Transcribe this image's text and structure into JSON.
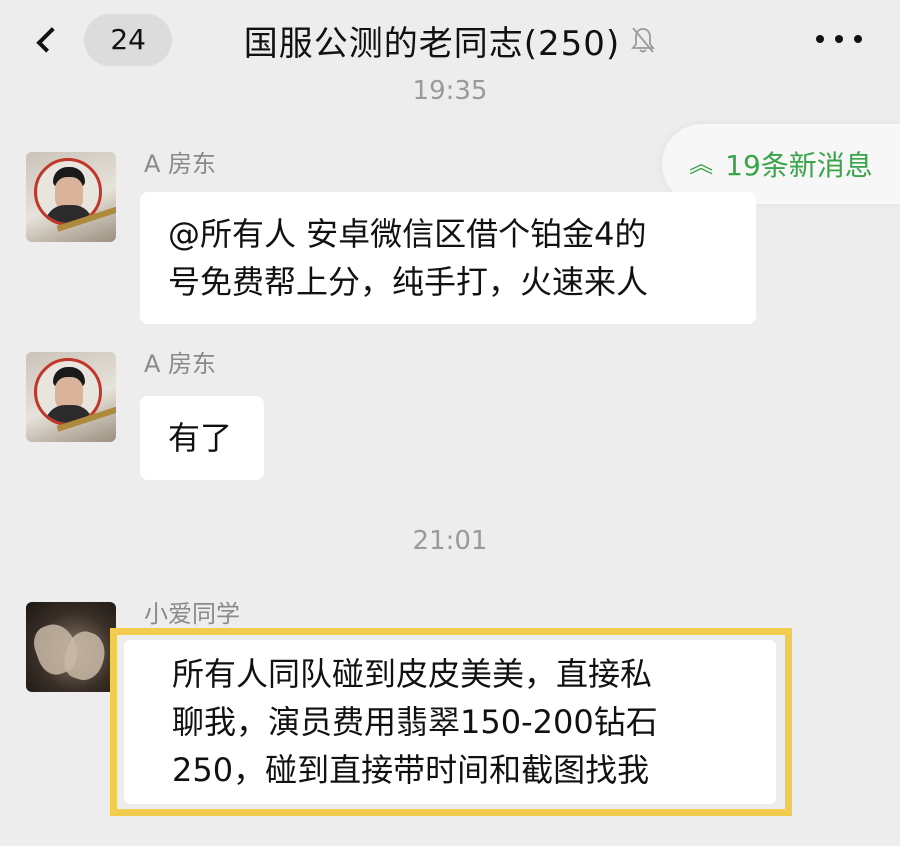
{
  "header": {
    "back_count": "24",
    "title": "国服公测的老同志(250)",
    "mute_icon": "bell-slash-icon",
    "more_icon": "more-dots-icon"
  },
  "timestamps": {
    "first": "19:35",
    "second": "21:01"
  },
  "new_messages": {
    "icon": "double-chevron-up-icon",
    "label": "19条新消息",
    "color": "#3aa44a"
  },
  "messages": [
    {
      "sender": "A 房东",
      "lines": [
        "@所有人 安卓微信区借个铂金4的",
        "号免费帮上分，纯手打，火速来人"
      ]
    },
    {
      "sender": "A 房东",
      "lines": [
        "有了"
      ]
    },
    {
      "sender": "小爱同学",
      "lines": [
        "所有人同队碰到皮皮美美，直接私",
        "聊我，演员费用翡翠150-200钻石",
        "250，碰到直接带时间和截图找我"
      ]
    }
  ],
  "colors": {
    "background": "#ededed",
    "bubble": "#ffffff",
    "highlight_border": "#f2cc4e",
    "timestamp": "#9a9a9a",
    "sender_name": "#8a8a8a"
  }
}
